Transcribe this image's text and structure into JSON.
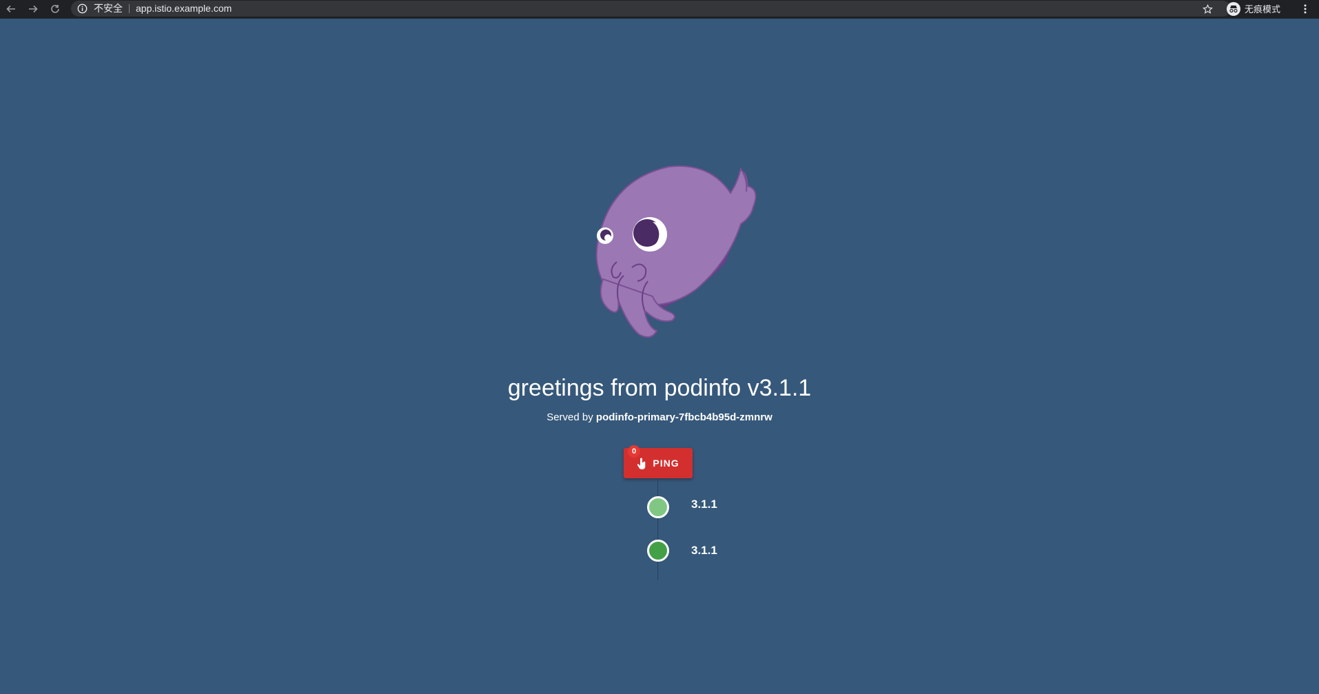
{
  "browser": {
    "security_label": "不安全",
    "url": "app.istio.example.com",
    "incognito_label": "无痕模式"
  },
  "page": {
    "title": "greetings from podinfo v3.1.1",
    "served_prefix": "Served by",
    "served_pod": "podinfo-primary-7fbcb4b95d-zmnrw",
    "ping_label": "PING",
    "ping_count": "0",
    "logo_icon": "podinfo-cuttlefish-logo"
  },
  "timeline": [
    {
      "version": "3.1.1",
      "color": "#81c784"
    },
    {
      "version": "3.1.1",
      "color": "#43a047"
    }
  ],
  "colors": {
    "background": "#36587a",
    "ping_button": "#d32f2f"
  }
}
